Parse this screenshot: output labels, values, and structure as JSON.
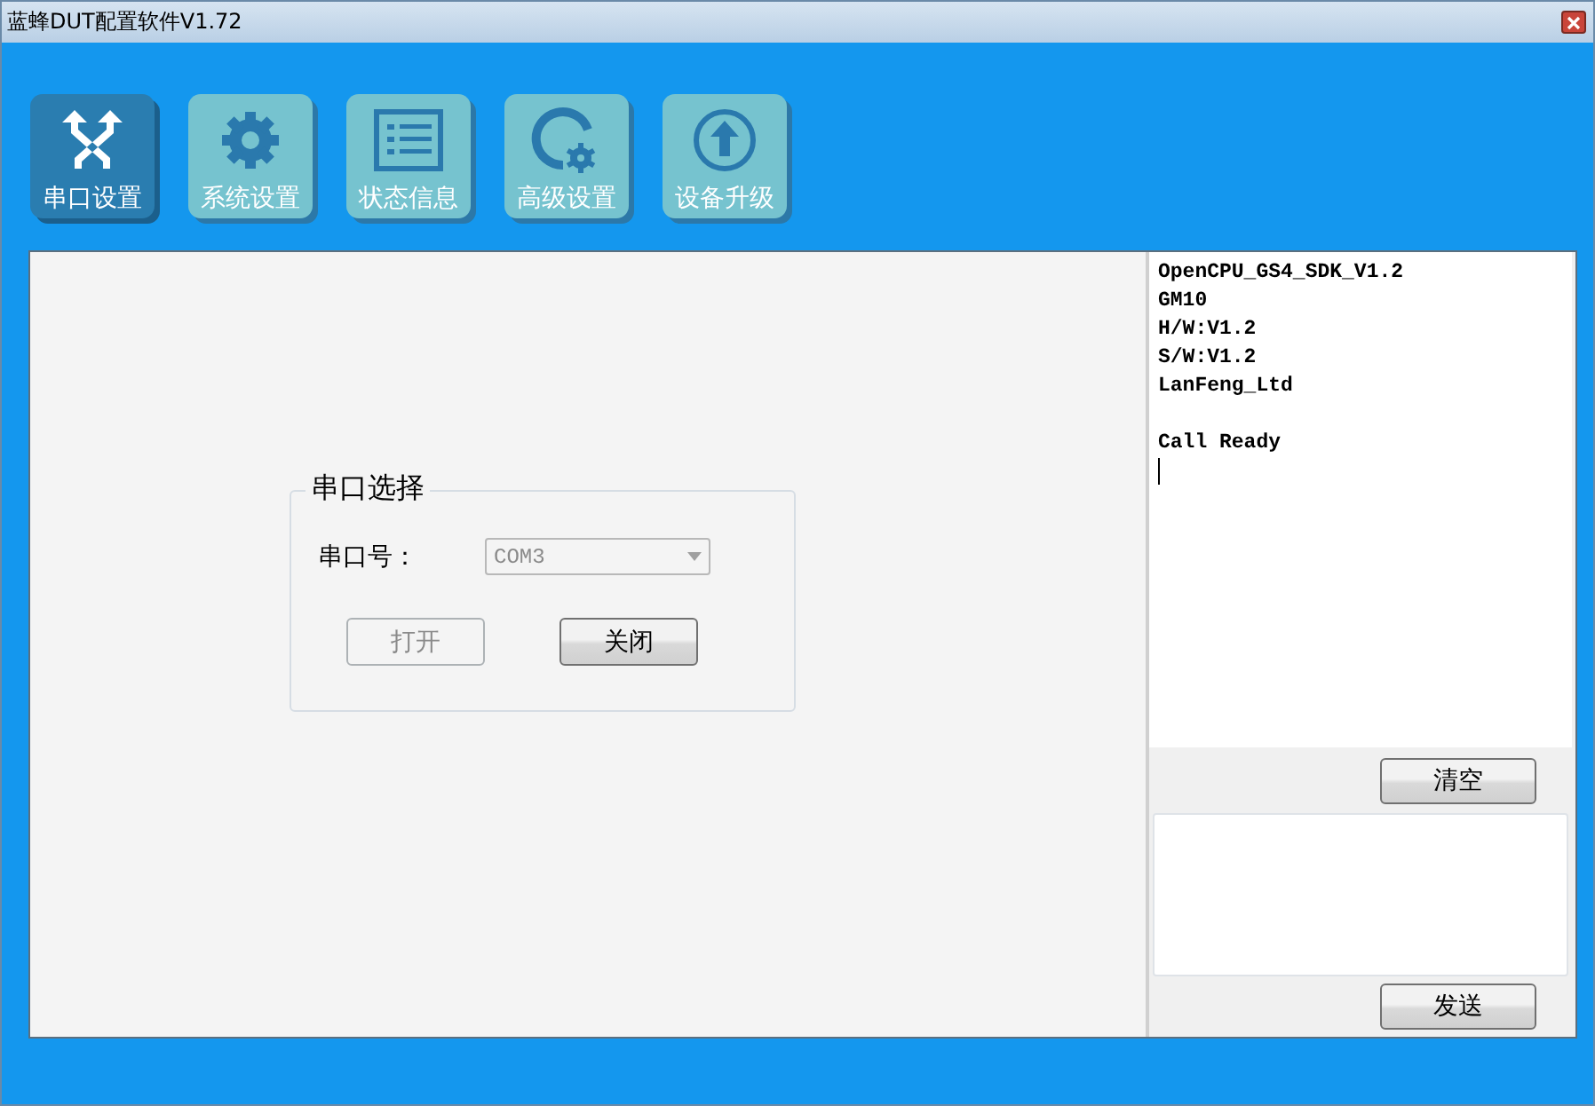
{
  "window": {
    "title": "蓝蜂DUT配置软件V1.72"
  },
  "nav": [
    {
      "label": "串口设置",
      "kind": "arrows",
      "selected": true
    },
    {
      "label": "系统设置",
      "kind": "gear",
      "selected": false
    },
    {
      "label": "状态信息",
      "kind": "list",
      "selected": false
    },
    {
      "label": "高级设置",
      "kind": "gauge",
      "selected": false
    },
    {
      "label": "设备升级",
      "kind": "upload",
      "selected": false
    }
  ],
  "port_group": {
    "title": "串口选择",
    "label": "串口号：",
    "port": {
      "value": "COM3",
      "disabled": true
    },
    "buttons": [
      {
        "label": "打开",
        "disabled": true
      },
      {
        "label": "关闭",
        "disabled": false
      }
    ]
  },
  "console": {
    "blocks": [
      [
        "OpenCPU_GS4_SDK_V1.2",
        "GM10",
        "H/W:V1.2",
        "S/W:V1.2",
        "LanFeng_Ltd"
      ],
      [
        "Call Ready"
      ]
    ],
    "clear_button": "清空",
    "send_button": "发送"
  }
}
